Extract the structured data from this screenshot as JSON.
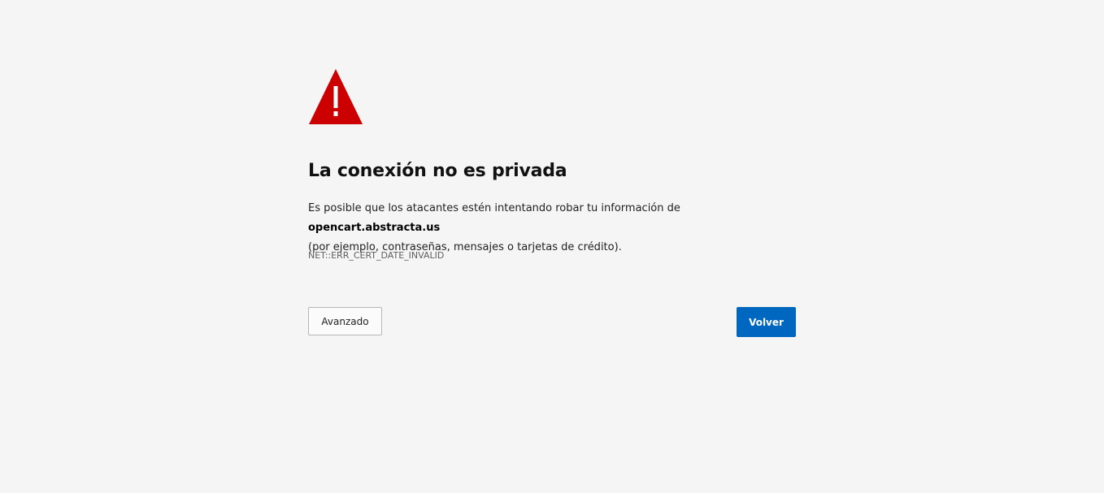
{
  "icon": {
    "name": "warning-triangle-icon",
    "color": "#cc0000"
  },
  "title": "La conexión no es privada",
  "description": {
    "before_host": "Es posible que los atacantes estén intentando robar tu información de ",
    "host": "opencart.abstracta.us",
    "after_host": "(por ejemplo, contraseñas, mensajes o tarjetas de crédito)."
  },
  "error_code": "NET::ERR_CERT_DATE_INVALID",
  "buttons": {
    "advanced_label": "Avanzado",
    "back_label": "Volver"
  },
  "colors": {
    "background": "#f5f5f5",
    "primary_button": "#0067c0"
  }
}
